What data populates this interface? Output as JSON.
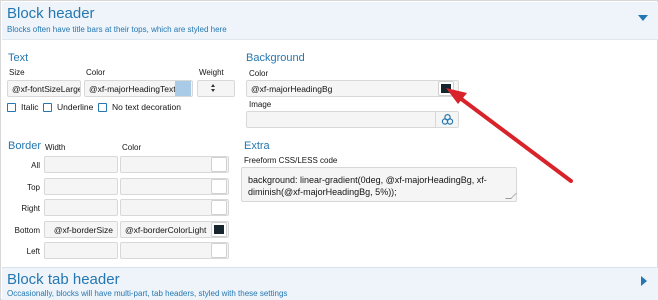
{
  "block_header": {
    "title": "Block header",
    "description": "Blocks often have title bars at their tops, which are styled here"
  },
  "text_group": {
    "title": "Text",
    "size_label": "Size",
    "size_value": "@xf-fontSizeLarger",
    "color_label": "Color",
    "color_value": "@xf-majorHeadingTextC",
    "color_swatch": "#a9cbe8",
    "weight_label": "Weight",
    "italic_label": "Italic",
    "underline_label": "Underline",
    "no_decoration_label": "No text decoration"
  },
  "background_group": {
    "title": "Background",
    "color_label": "Color",
    "color_value": "@xf-majorHeadingBg",
    "color_swatch": "#17252f",
    "image_label": "Image",
    "image_value": ""
  },
  "border_group": {
    "title": "Border",
    "width_label": "Width",
    "color_label": "Color",
    "rows": [
      {
        "label": "All",
        "width": "",
        "color": ""
      },
      {
        "label": "Top",
        "width": "",
        "color": ""
      },
      {
        "label": "Right",
        "width": "",
        "color": ""
      },
      {
        "label": "Bottom",
        "width": "@xf-borderSize",
        "color": "@xf-borderColorLight",
        "swatch": "#17252f"
      },
      {
        "label": "Left",
        "width": "",
        "color": ""
      }
    ]
  },
  "extra_group": {
    "title": "Extra",
    "freeform_label": "Freeform CSS/LESS code",
    "freeform_value": "background: linear-gradient(0deg, @xf-majorHeadingBg, xf-diminish(@xf-majorHeadingBg, 5%));"
  },
  "block_tab_header": {
    "title": "Block tab header",
    "description": "Occasionally, blocks will have multi-part, tab headers, styled with these settings"
  },
  "colors": {
    "accent": "#2577b1",
    "annotation_arrow": "#d8232a"
  },
  "icons": {
    "expand": "triangle-down-icon",
    "collapse": "triangle-right-icon",
    "image_picker": "image-picker-icon"
  }
}
